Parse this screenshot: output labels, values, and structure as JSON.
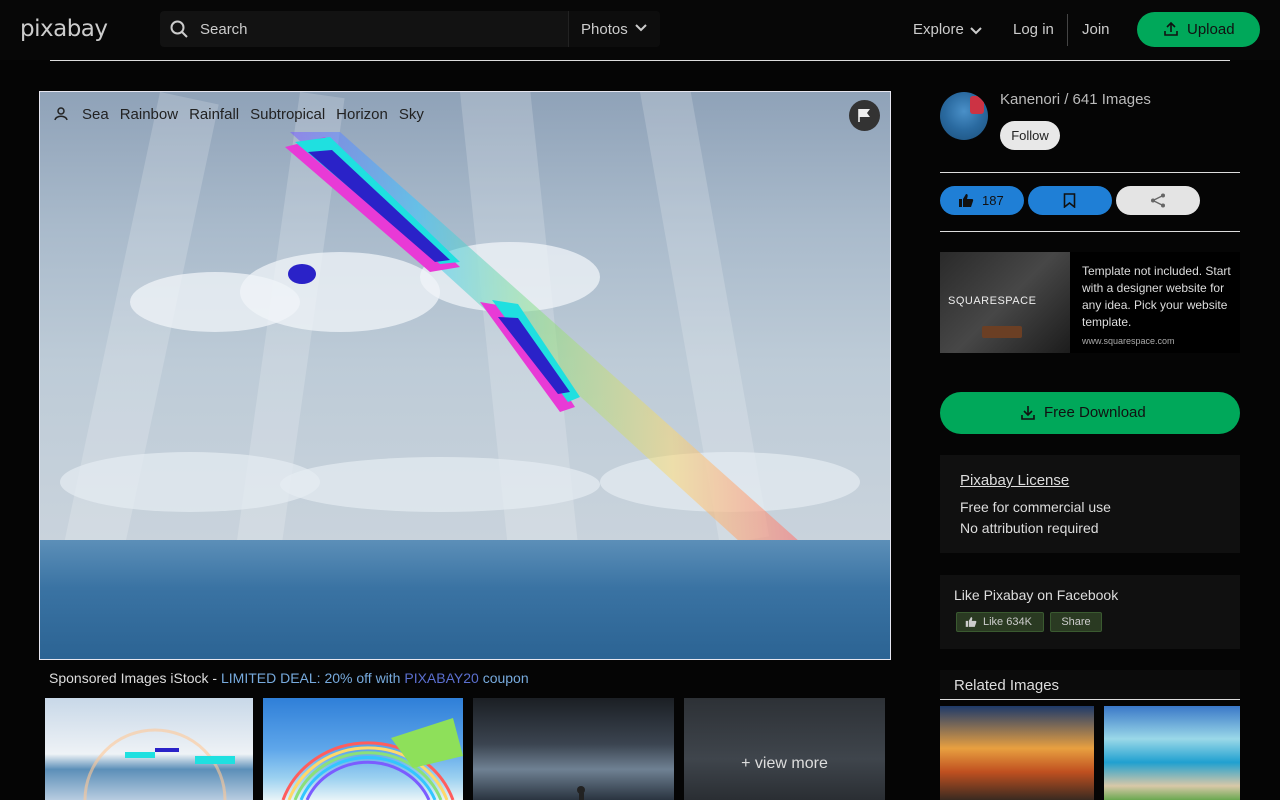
{
  "header": {
    "logo": "pixabay",
    "search_placeholder": "Search",
    "media_type": "Photos",
    "nav": {
      "explore": "Explore",
      "login": "Log in",
      "join": "Join",
      "upload": "Upload"
    }
  },
  "photo": {
    "tags": [
      "Sea",
      "Rainbow",
      "Rainfall",
      "Subtropical",
      "Horizon",
      "Sky"
    ]
  },
  "sponsored": {
    "prefix": "Sponsored Images iStock - ",
    "deal": "LIMITED DEAL: 20% off with ",
    "code": "PIXABAY20",
    "suffix": " coupon",
    "view_more": "+ view more"
  },
  "sidebar": {
    "author": "Kanenori / 641 Images",
    "follow": "Follow",
    "likes": "187",
    "ad": {
      "brand": "SQUARESPACE",
      "text": "Template not included. Start with a designer website for any idea. Pick your website template.",
      "cta": "www.squarespace.com"
    },
    "download": "Free Download",
    "license": {
      "title": "Pixabay License",
      "line1": "Free for commercial use",
      "line2": "No attribution required"
    },
    "facebook": {
      "title": "Like Pixabay on Facebook",
      "like": "Like 634K",
      "share": "Share"
    },
    "related_title": "Related Images"
  },
  "colors": {
    "accent_green": "#00a85a",
    "accent_blue": "#1f7fd6",
    "background": "#050505"
  }
}
